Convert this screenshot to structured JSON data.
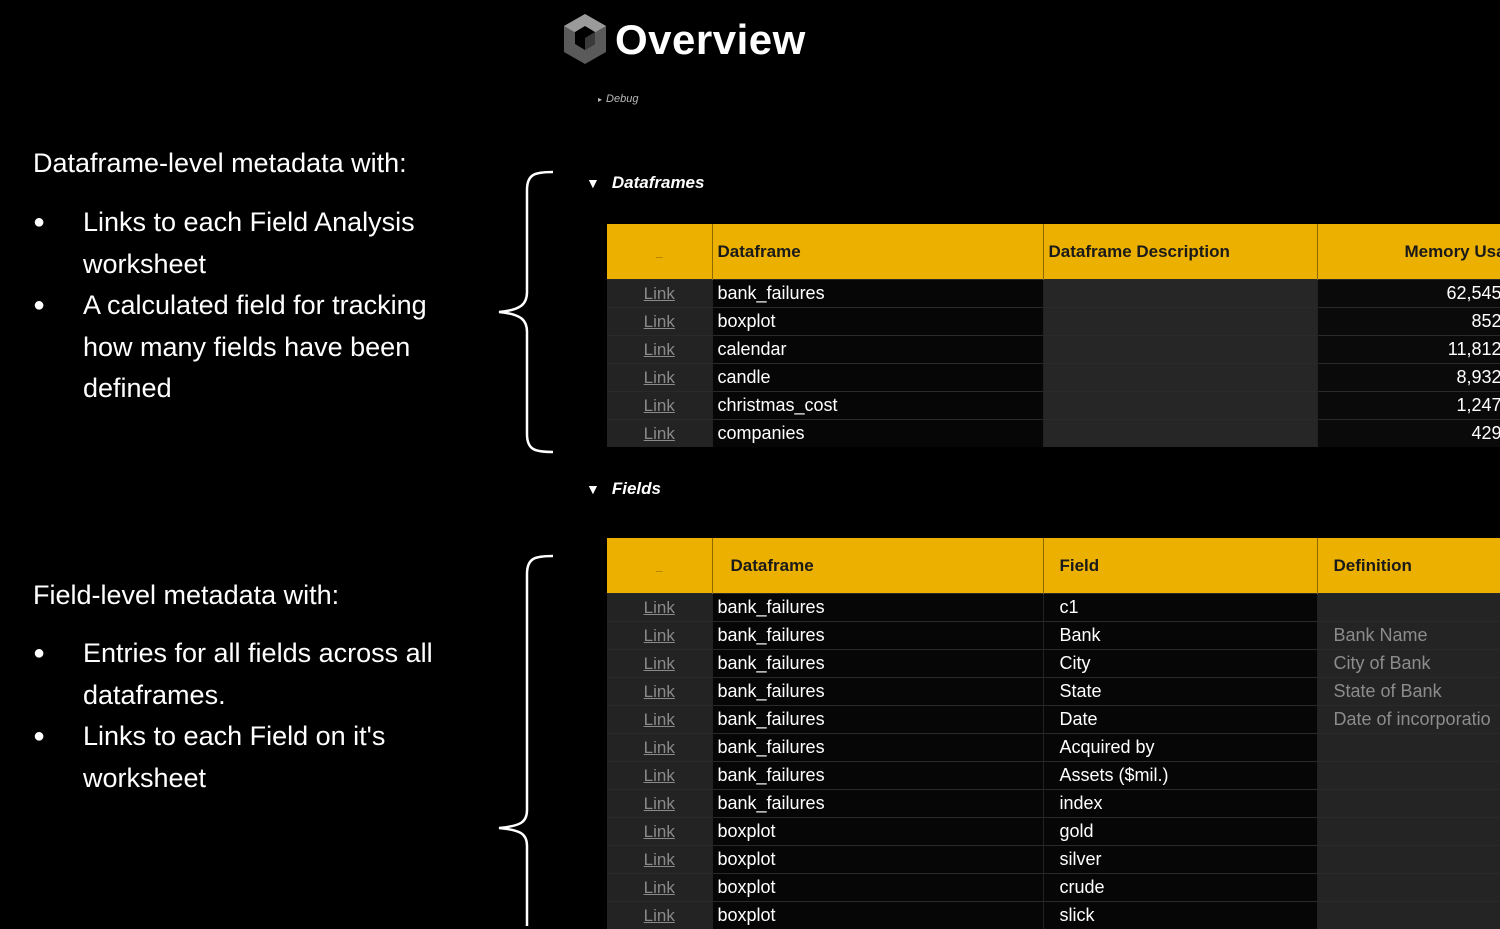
{
  "header": {
    "title": "Overview",
    "debug_label": "Debug"
  },
  "notes": {
    "dataframe": {
      "heading": "Dataframe-level metadata with:",
      "bullets": [
        "Links to each Field Analysis worksheet",
        "A calculated field for tracking how many fields have been defined"
      ]
    },
    "field": {
      "heading": "Field-level metadata with:",
      "bullets": [
        "Entries for all fields across all dataframes.",
        "Links to each Field on it's worksheet"
      ]
    }
  },
  "dataframes_section": {
    "label": "Dataframes",
    "columns": [
      "_",
      "Dataframe",
      "Dataframe Description",
      "Memory Usage (I"
    ],
    "rows": [
      {
        "link": "Link",
        "dataframe": "bank_failures",
        "description": "",
        "memory": "62,545"
      },
      {
        "link": "Link",
        "dataframe": "boxplot",
        "description": "",
        "memory": "852"
      },
      {
        "link": "Link",
        "dataframe": "calendar",
        "description": "",
        "memory": "11,812"
      },
      {
        "link": "Link",
        "dataframe": "candle",
        "description": "",
        "memory": "8,932"
      },
      {
        "link": "Link",
        "dataframe": "christmas_cost",
        "description": "",
        "memory": "1,247"
      },
      {
        "link": "Link",
        "dataframe": "companies",
        "description": "",
        "memory": "429"
      }
    ]
  },
  "fields_section": {
    "label": "Fields",
    "columns": [
      "_",
      "Dataframe",
      "Field",
      "Definition"
    ],
    "rows": [
      {
        "link": "Link",
        "dataframe": "bank_failures",
        "field": "c1",
        "definition": ""
      },
      {
        "link": "Link",
        "dataframe": "bank_failures",
        "field": "Bank",
        "definition": "Bank Name"
      },
      {
        "link": "Link",
        "dataframe": "bank_failures",
        "field": "City",
        "definition": "City of Bank"
      },
      {
        "link": "Link",
        "dataframe": "bank_failures",
        "field": "State",
        "definition": "State of Bank"
      },
      {
        "link": "Link",
        "dataframe": "bank_failures",
        "field": "Date",
        "definition": "Date of incorporatio"
      },
      {
        "link": "Link",
        "dataframe": "bank_failures",
        "field": "Acquired by",
        "definition": ""
      },
      {
        "link": "Link",
        "dataframe": "bank_failures",
        "field": "Assets ($mil.)",
        "definition": ""
      },
      {
        "link": "Link",
        "dataframe": "bank_failures",
        "field": "index",
        "definition": ""
      },
      {
        "link": "Link",
        "dataframe": "boxplot",
        "field": "gold",
        "definition": ""
      },
      {
        "link": "Link",
        "dataframe": "boxplot",
        "field": "silver",
        "definition": ""
      },
      {
        "link": "Link",
        "dataframe": "boxplot",
        "field": "crude",
        "definition": ""
      },
      {
        "link": "Link",
        "dataframe": "boxplot",
        "field": "slick",
        "definition": ""
      }
    ]
  },
  "colors": {
    "header_accent": "#ebb000",
    "background": "#000000"
  }
}
